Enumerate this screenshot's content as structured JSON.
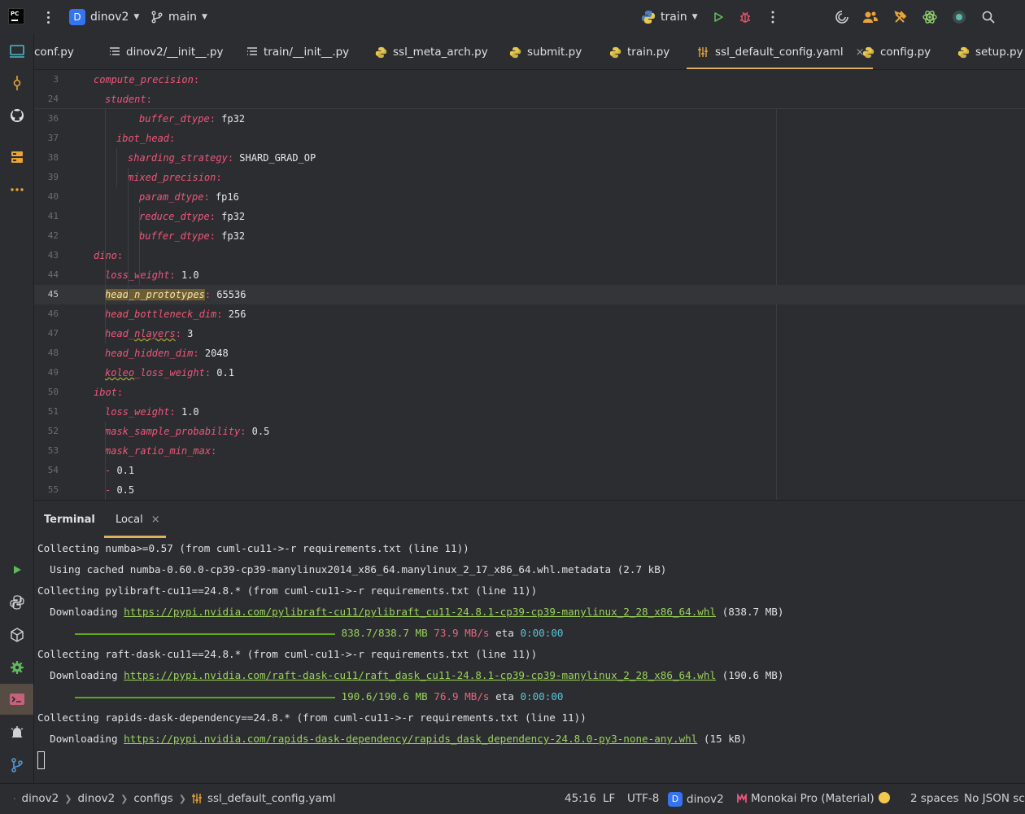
{
  "titlebar": {
    "project_badge": "D",
    "project": "dinov2",
    "branch": "main",
    "run_config": "train"
  },
  "tabs": [
    {
      "label": "conf.py",
      "icon": "python-icon"
    },
    {
      "label": "dinov2/__init__.py",
      "icon": "structure-icon"
    },
    {
      "label": "train/__init__.py",
      "icon": "structure-icon"
    },
    {
      "label": "ssl_meta_arch.py",
      "icon": "python-icon"
    },
    {
      "label": "submit.py",
      "icon": "python-icon"
    },
    {
      "label": "train.py",
      "icon": "python-icon"
    },
    {
      "label": "ssl_default_config.yaml",
      "icon": "yaml-icon",
      "active": true
    },
    {
      "label": "config.py",
      "icon": "python-icon"
    },
    {
      "label": "setup.py",
      "icon": "python-icon"
    }
  ],
  "tab_close": "×",
  "editor": {
    "lines": [
      {
        "n": "3",
        "indent": 0,
        "key": "compute_precision",
        "value": ""
      },
      {
        "n": "24",
        "indent": 1,
        "key": "student",
        "value": ""
      },
      {
        "n": "36",
        "indent": 4,
        "key": "buffer_dtype",
        "value": "fp32"
      },
      {
        "n": "37",
        "indent": 2,
        "key": "ibot_head",
        "value": ""
      },
      {
        "n": "38",
        "indent": 3,
        "key": "sharding_strategy",
        "value": "SHARD_GRAD_OP"
      },
      {
        "n": "39",
        "indent": 3,
        "key": "mixed_precision",
        "value": ""
      },
      {
        "n": "40",
        "indent": 4,
        "key": "param_dtype",
        "value": "fp16"
      },
      {
        "n": "41",
        "indent": 4,
        "key": "reduce_dtype",
        "value": "fp32"
      },
      {
        "n": "42",
        "indent": 4,
        "key": "buffer_dtype",
        "value": "fp32"
      },
      {
        "n": "43",
        "indent": 0,
        "key": "dino",
        "value": ""
      },
      {
        "n": "44",
        "indent": 1,
        "key": "loss_weight",
        "value": "1.0"
      },
      {
        "n": "45",
        "indent": 1,
        "key": "head_n_prototypes",
        "value": "65536",
        "current": true,
        "highlight": true
      },
      {
        "n": "46",
        "indent": 1,
        "key": "head_bottleneck_dim",
        "value": "256"
      },
      {
        "n": "47",
        "indent": 1,
        "key": "head_nlayers",
        "value": "3",
        "squiggle": "nlayers"
      },
      {
        "n": "48",
        "indent": 1,
        "key": "head_hidden_dim",
        "value": "2048"
      },
      {
        "n": "49",
        "indent": 1,
        "key": "koleo_loss_weight",
        "value": "0.1",
        "squiggle": "koleo"
      },
      {
        "n": "50",
        "indent": 0,
        "key": "ibot",
        "value": ""
      },
      {
        "n": "51",
        "indent": 1,
        "key": "loss_weight",
        "value": "1.0"
      },
      {
        "n": "52",
        "indent": 1,
        "key": "mask_sample_probability",
        "value": "0.5"
      },
      {
        "n": "53",
        "indent": 1,
        "key": "mask_ratio_min_max",
        "value": ""
      },
      {
        "n": "54",
        "indent": 1,
        "item": "0.1"
      },
      {
        "n": "55",
        "indent": 1,
        "item": "0.5"
      }
    ]
  },
  "terminal": {
    "title": "Terminal",
    "tab": "Local",
    "tab_close": "×",
    "lines": [
      {
        "text": "Collecting numba>=0.57 (from cuml-cu11->-r requirements.txt (line 11))"
      },
      {
        "text": "  Using cached numba-0.60.0-cp39-cp39-manylinux2014_x86_64.manylinux_2_17_x86_64.whl.metadata (2.7 kB)"
      },
      {
        "text": "Collecting pylibraft-cu11==24.8.* (from cuml-cu11->-r requirements.txt (line 11))"
      },
      {
        "prefix": "  Downloading ",
        "url": "https://pypi.nvidia.com/pylibraft-cu11/pylibraft_cu11-24.8.1-cp39-cp39-manylinux_2_28_x86_64.whl",
        "suffix": " (838.7 MB)"
      },
      {
        "progress": true,
        "done": "838.7/838.7 MB",
        "speed": "73.9 MB/s",
        "eta_label": "eta",
        "eta": "0:00:00"
      },
      {
        "text": "Collecting raft-dask-cu11==24.8.* (from cuml-cu11->-r requirements.txt (line 11))"
      },
      {
        "prefix": "  Downloading ",
        "url": "https://pypi.nvidia.com/raft-dask-cu11/raft_dask_cu11-24.8.1-cp39-cp39-manylinux_2_28_x86_64.whl",
        "suffix": " (190.6 MB)"
      },
      {
        "progress": true,
        "done": "190.6/190.6 MB",
        "speed": "76.9 MB/s",
        "eta_label": "eta",
        "eta": "0:00:00"
      },
      {
        "text": "Collecting rapids-dask-dependency==24.8.* (from cuml-cu11->-r requirements.txt (line 11))"
      },
      {
        "prefix": "  Downloading ",
        "url": "https://pypi.nvidia.com/rapids-dask-dependency/rapids_dask_dependency-24.8.0-py3-none-any.whl",
        "suffix": " (15 kB)"
      }
    ]
  },
  "statusbar": {
    "breadcrumb": [
      "dinov2",
      "dinov2",
      "configs",
      "ssl_default_config.yaml"
    ],
    "position": "45:16",
    "line_sep": "LF",
    "encoding": "UTF-8",
    "interpreter_badge": "D",
    "interpreter": "dinov2",
    "theme": "Monokai Pro (Material)",
    "indent": "2 spaces",
    "schema": "No JSON schema"
  },
  "colors": {
    "accent": "#e0b060",
    "key": "#f0567a",
    "url": "#9bd25a",
    "progress": "#5ea819"
  }
}
